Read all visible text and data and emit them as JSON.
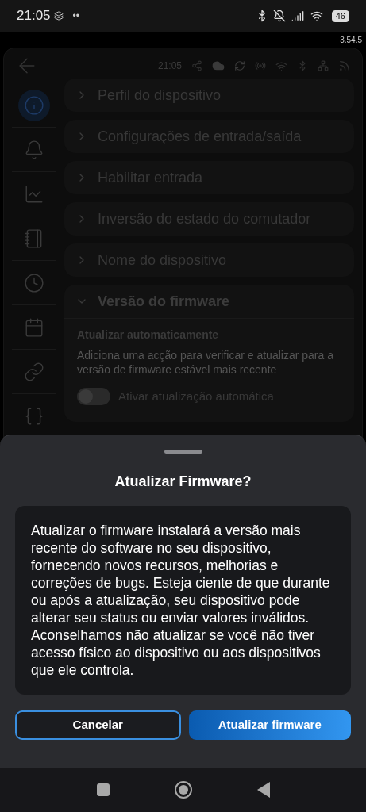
{
  "status_bar": {
    "time": "21:05",
    "dots": "••",
    "battery": "46"
  },
  "app_version": "3.54.5",
  "header": {
    "time": "21:05"
  },
  "sidebar": {
    "items": [
      {
        "kind": "info",
        "selected": true
      },
      {
        "kind": "bell",
        "selected": false
      },
      {
        "kind": "chart",
        "selected": false
      },
      {
        "kind": "notebook",
        "selected": false
      },
      {
        "kind": "clock",
        "selected": false
      },
      {
        "kind": "calendar",
        "selected": false
      },
      {
        "kind": "link",
        "selected": false
      },
      {
        "kind": "braces",
        "selected": false
      }
    ]
  },
  "sections": [
    {
      "title": "Perfil do dispositivo",
      "expanded": false
    },
    {
      "title": "Configurações de entrada/saída",
      "expanded": false
    },
    {
      "title": "Habilitar entrada",
      "expanded": false
    },
    {
      "title": "Inversão do estado do comutador",
      "expanded": false
    },
    {
      "title": "Nome do dispositivo",
      "expanded": false
    },
    {
      "title": "Versão do firmware",
      "expanded": true,
      "subtitle": "Atualizar automaticamente",
      "description": "Adiciona uma acção para verificar e atualizar para a versão de firmware estável mais recente",
      "toggle": {
        "label": "Ativar atualização automática",
        "on": false
      }
    }
  ],
  "dialog": {
    "title": "Atualizar Firmware?",
    "body": "Atualizar o firmware instalará a versão mais recente do software no seu dispositivo, fornecendo novos recursos, melhorias e correções de bugs. Esteja ciente de que durante ou após a atualização, seu dispositivo pode alterar seu status ou enviar valores inválidos. Aconselhamos não atualizar se você não tiver acesso físico ao dispositivo ou aos dispositivos que ele controla.",
    "buttons": [
      {
        "label": "Cancelar",
        "kind": "secondary"
      },
      {
        "label": "Atualizar firmware",
        "kind": "primary"
      }
    ]
  }
}
